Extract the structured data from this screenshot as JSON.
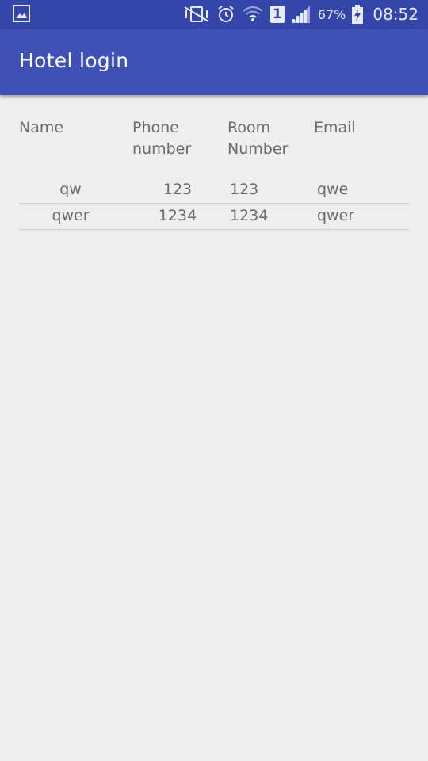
{
  "status_bar": {
    "battery_percent": "67%",
    "time": "08:52",
    "sim_slot": "1",
    "icons": [
      "gallery-icon",
      "vibrate-icon",
      "alarm-icon",
      "wifi-icon",
      "sim-icon",
      "signal-icon",
      "battery-charging-icon"
    ]
  },
  "app_bar": {
    "title": "Hotel login",
    "color": "#3f51b5"
  },
  "table": {
    "headers": {
      "name": "Name",
      "phone_line1": "Phone",
      "phone_line2": "number",
      "room_line1": "Room",
      "room_line2": "Number",
      "email": "Email"
    },
    "rows": [
      {
        "name": "qw",
        "phone": "123",
        "room": "123",
        "email": "qwe"
      },
      {
        "name": "qwer",
        "phone": "1234",
        "room": "1234",
        "email": "qwer"
      }
    ]
  }
}
